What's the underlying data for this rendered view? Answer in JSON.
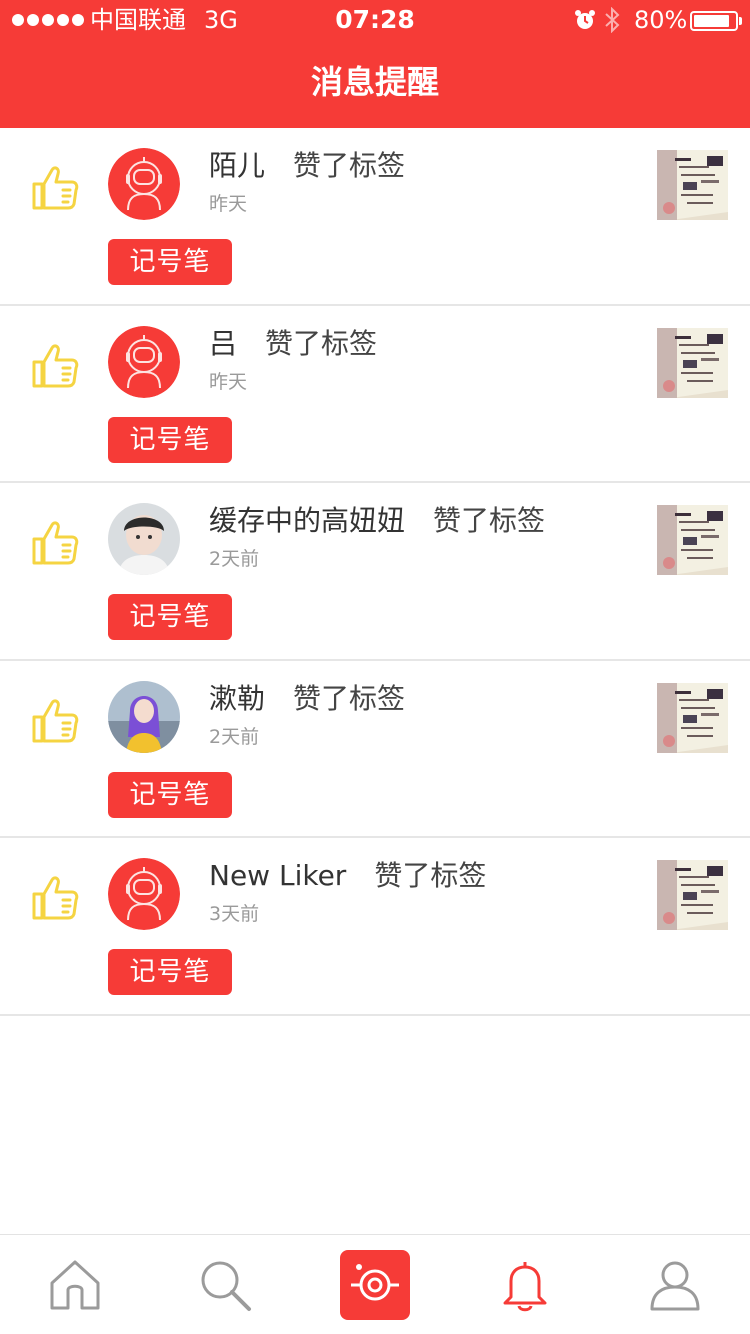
{
  "status_bar": {
    "carrier": "中国联通",
    "network": "3G",
    "time": "07:28",
    "battery_percent": "80%",
    "battery_level": 0.8,
    "icons": [
      "signal-dots",
      "alarm-icon",
      "bluetooth-icon",
      "battery-icon"
    ]
  },
  "header": {
    "title": "消息提醒"
  },
  "notifications": [
    {
      "name": "陌儿",
      "action": "赞了标签",
      "time": "昨天",
      "tag": "记号笔",
      "avatar": "default-astronaut-avatar"
    },
    {
      "name": "吕",
      "action": "赞了标签",
      "time": "昨天",
      "tag": "记号笔",
      "avatar": "default-astronaut-avatar"
    },
    {
      "name": "缓存中的高妞妞",
      "action": "赞了标签",
      "time": "2天前",
      "tag": "记号笔",
      "avatar": "photo-avatar-boy"
    },
    {
      "name": "漱勒",
      "action": "赞了标签",
      "time": "2天前",
      "tag": "记号笔",
      "avatar": "photo-avatar-purple-hair"
    },
    {
      "name": "New Liker",
      "action": "赞了标签",
      "time": "3天前",
      "tag": "记号笔",
      "avatar": "default-astronaut-avatar"
    }
  ],
  "tabbar": {
    "tabs": [
      "home-icon",
      "search-icon",
      "camera-icon",
      "bell-icon",
      "user-icon"
    ],
    "active": "bell-icon"
  },
  "colors": {
    "brand_red": "#f63b37",
    "like_yellow": "#f5d442",
    "muted_gray": "#9a9a9a",
    "tab_gray": "#9b9b9b"
  }
}
